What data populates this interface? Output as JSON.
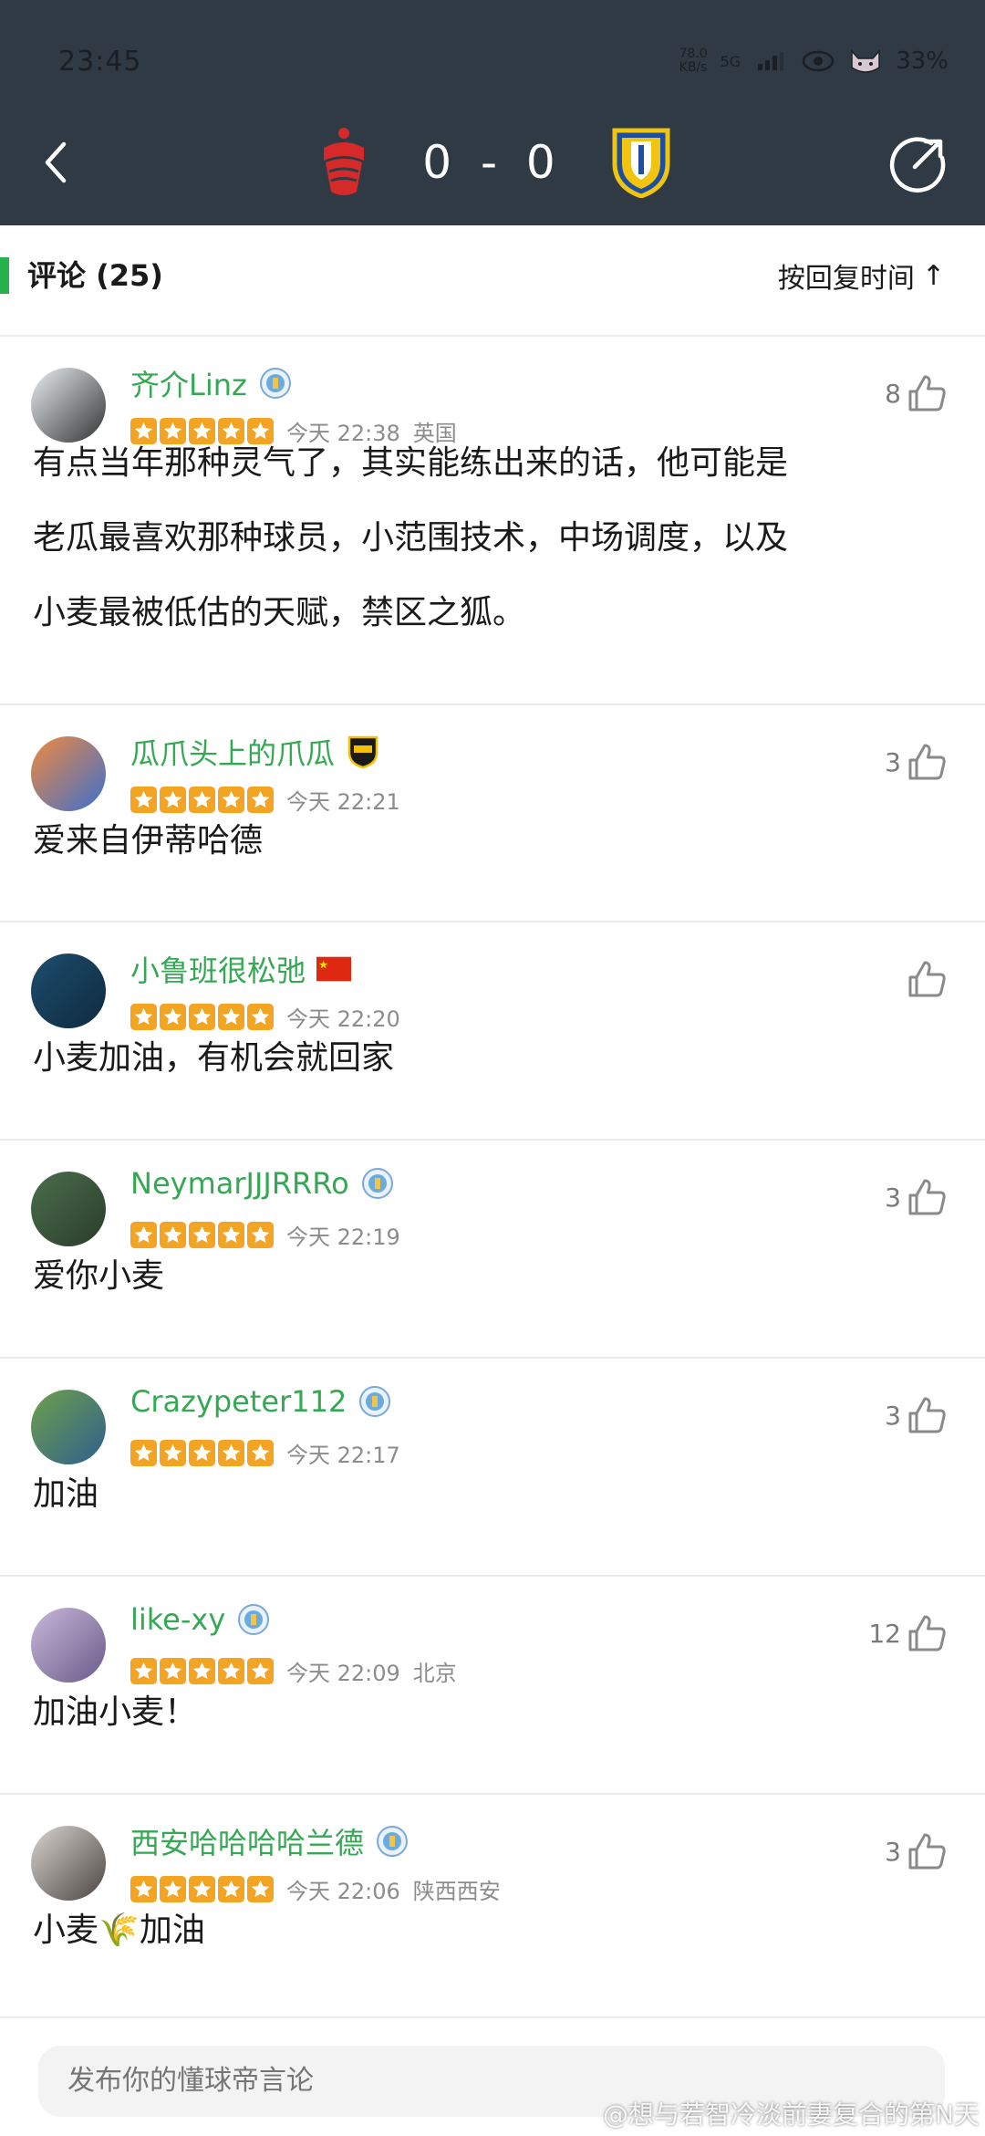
{
  "status_bar": {
    "time": "23:45",
    "net_speed_value": "78.0",
    "net_speed_unit": "KB/s",
    "network": "5G",
    "battery": "33%"
  },
  "match": {
    "score": "0 - 0",
    "home_badge_icon": "nottingham-forest-badge-icon",
    "away_badge_icon": "leeds-united-badge-icon"
  },
  "comments_header": {
    "title": "评论 (25)",
    "sort_label": "按回复时间",
    "sort_arrow": "↑",
    "accent": "#26b14a"
  },
  "colors": {
    "header_bg": "#2f3a44",
    "username": "#34a853",
    "star": "#f4a423",
    "meta": "#8c8c8c"
  },
  "comments": [
    {
      "username": "齐介Linz",
      "team_icon": "man-city-badge-icon",
      "stars": 5,
      "time": "今天 22:38",
      "location": "英国",
      "likes": "8",
      "text_lines": [
        "有点当年那种灵气了，其实能练出来的话，他可能是",
        "老瓜最喜欢那种球员，小范围技术，中场调度，以及",
        "小麦最被低估的天赋，禁区之狐。"
      ]
    },
    {
      "username": "瓜爪头上的爪瓜",
      "team_icon": "yellow-club-badge-icon",
      "stars": 5,
      "time": "今天 22:21",
      "location": "",
      "likes": "3",
      "text_lines": [
        "爱来自伊蒂哈德"
      ]
    },
    {
      "username": "小鲁班很松弛",
      "team_icon": "china-flag-icon",
      "stars": 5,
      "time": "今天 22:20",
      "location": "",
      "likes": "",
      "text_lines": [
        "小麦加油，有机会就回家"
      ]
    },
    {
      "username": "NeymarJJJRRRo",
      "team_icon": "man-city-badge-icon",
      "stars": 5,
      "time": "今天 22:19",
      "location": "",
      "likes": "3",
      "text_lines": [
        "爱你小麦"
      ]
    },
    {
      "username": "Crazypeter112",
      "team_icon": "man-city-badge-icon",
      "stars": 5,
      "time": "今天 22:17",
      "location": "",
      "likes": "3",
      "text_lines": [
        "加油"
      ]
    },
    {
      "username": "like-xy",
      "team_icon": "man-city-badge-icon",
      "stars": 5,
      "time": "今天 22:09",
      "location": "北京",
      "likes": "12",
      "text_lines": [
        "加油小麦！"
      ]
    },
    {
      "username": "西安哈哈哈哈兰德",
      "team_icon": "man-city-badge-icon",
      "stars": 5,
      "time": "今天 22:06",
      "location": "陕西西安",
      "likes": "3",
      "text_lines": [
        "小麦🌾加油"
      ]
    }
  ],
  "bottom": {
    "input_placeholder": "发布你的懂球帝言论"
  },
  "watermark": "@想与若智冷淡前妻复合的第N天"
}
